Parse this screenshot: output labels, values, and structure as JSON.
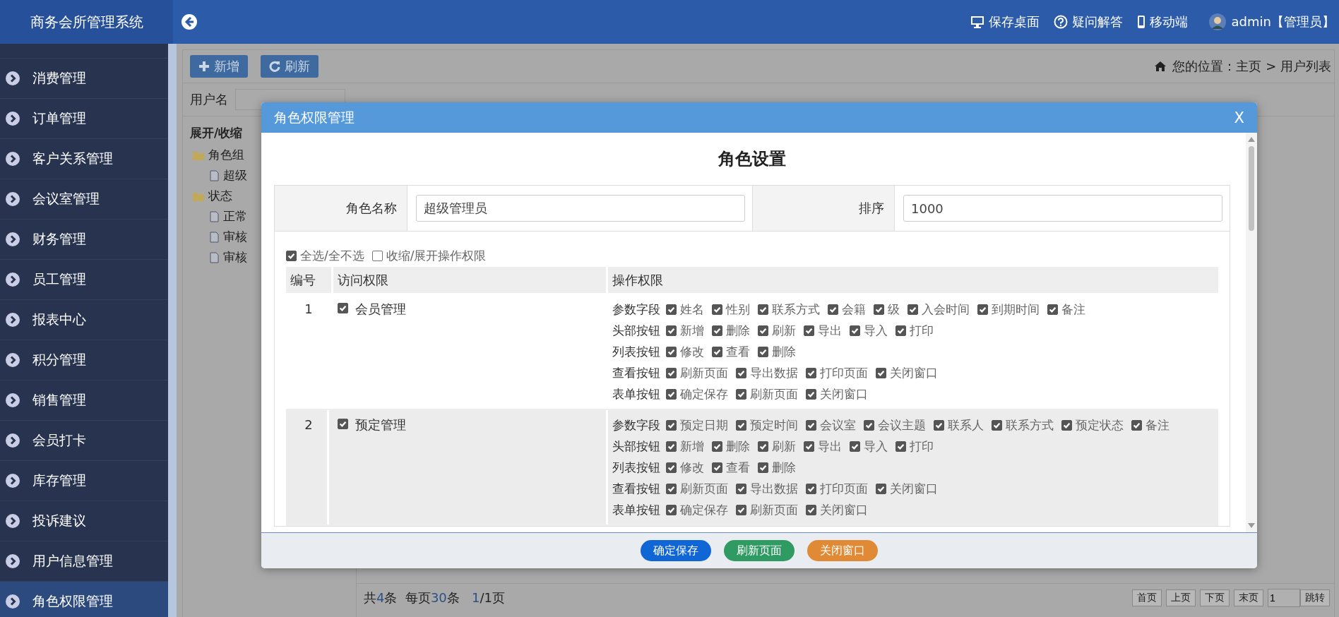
{
  "header": {
    "title": "商务会所管理系统",
    "links": [
      {
        "kind": "desktop",
        "label": "保存桌面"
      },
      {
        "kind": "help",
        "label": "疑问解答"
      },
      {
        "kind": "mobile",
        "label": "移动端"
      }
    ],
    "user": "admin【管理员】"
  },
  "sidebar": {
    "items": [
      {
        "label": "消费管理",
        "selected": false
      },
      {
        "label": "订单管理",
        "selected": false
      },
      {
        "label": "客户关系管理",
        "selected": false
      },
      {
        "label": "会议室管理",
        "selected": false
      },
      {
        "label": "财务管理",
        "selected": false
      },
      {
        "label": "员工管理",
        "selected": false
      },
      {
        "label": "报表中心",
        "selected": false
      },
      {
        "label": "积分管理",
        "selected": false
      },
      {
        "label": "销售管理",
        "selected": false
      },
      {
        "label": "会员打卡",
        "selected": false
      },
      {
        "label": "库存管理",
        "selected": false
      },
      {
        "label": "投诉建议",
        "selected": false
      },
      {
        "label": "用户信息管理",
        "selected": false
      },
      {
        "label": "角色权限管理",
        "selected": true
      }
    ]
  },
  "toolbar": {
    "buttons": [
      {
        "kind": "add",
        "label": "新增"
      },
      {
        "kind": "refresh",
        "label": "刷新"
      }
    ],
    "breadcrumb": "您的位置：主页 > 用户列表"
  },
  "search": {
    "label": "用户名"
  },
  "tree": {
    "root": "展开/收缩",
    "nodes": [
      {
        "label": "角色组",
        "children": [
          {
            "label": "超级"
          }
        ]
      },
      {
        "label": "状态",
        "children": [
          {
            "label": "正常"
          },
          {
            "label": "审核"
          },
          {
            "label": "审核"
          }
        ]
      }
    ]
  },
  "pager": {
    "summary": [
      {
        "kind": "label",
        "text": "共"
      },
      {
        "kind": "number",
        "text": "4"
      },
      {
        "kind": "label",
        "text": "条  每页"
      },
      {
        "kind": "number",
        "text": "30"
      },
      {
        "kind": "label",
        "text": "条   "
      },
      {
        "kind": "number",
        "text": "1"
      },
      {
        "kind": "label",
        "text": "/1页"
      }
    ],
    "buttons": [
      "首页",
      "上页",
      "下页",
      "末页"
    ],
    "page_input": "1",
    "go": "跳转"
  },
  "modal": {
    "title": "角色权限管理",
    "close": "X",
    "heading": "角色设置",
    "fields": [
      {
        "label": "角色名称",
        "value": "超级管理员"
      },
      {
        "label": "排序",
        "value": "1000"
      }
    ],
    "options": [
      {
        "label": "全选/全不选",
        "checked": true
      },
      {
        "label": "收缩/展开操作权限",
        "checked": false
      }
    ],
    "columns": [
      "编号",
      "访问权限",
      "操作权限"
    ],
    "rows": [
      {
        "no": "1",
        "module": "会员管理",
        "checked": true,
        "groups": [
          {
            "label": "参数字段",
            "items": [
              {
                "label": "姓名",
                "checked": true
              },
              {
                "label": "性别",
                "checked": true
              },
              {
                "label": "联系方式",
                "checked": true
              },
              {
                "label": "会籍",
                "checked": true
              },
              {
                "label": "级",
                "checked": true
              },
              {
                "label": "入会时间",
                "checked": true
              },
              {
                "label": "到期时间",
                "checked": true
              },
              {
                "label": "备注",
                "checked": true
              }
            ]
          },
          {
            "label": "头部按钮",
            "items": [
              {
                "label": "新增",
                "checked": true
              },
              {
                "label": "删除",
                "checked": true
              },
              {
                "label": "刷新",
                "checked": true
              },
              {
                "label": "导出",
                "checked": true
              },
              {
                "label": "导入",
                "checked": true
              },
              {
                "label": "打印",
                "checked": true
              }
            ]
          },
          {
            "label": "列表按钮",
            "items": [
              {
                "label": "修改",
                "checked": true
              },
              {
                "label": "查看",
                "checked": true
              },
              {
                "label": "删除",
                "checked": true
              }
            ]
          },
          {
            "label": "查看按钮",
            "items": [
              {
                "label": "刷新页面",
                "checked": true
              },
              {
                "label": "导出数据",
                "checked": true
              },
              {
                "label": "打印页面",
                "checked": true
              },
              {
                "label": "关闭窗口",
                "checked": true
              }
            ]
          },
          {
            "label": "表单按钮",
            "items": [
              {
                "label": "确定保存",
                "checked": true
              },
              {
                "label": "刷新页面",
                "checked": true
              },
              {
                "label": "关闭窗口",
                "checked": true
              }
            ]
          }
        ]
      },
      {
        "no": "2",
        "module": "预定管理",
        "checked": true,
        "groups": [
          {
            "label": "参数字段",
            "items": [
              {
                "label": "预定日期",
                "checked": true
              },
              {
                "label": "预定时间",
                "checked": true
              },
              {
                "label": "会议室",
                "checked": true
              },
              {
                "label": "会议主题",
                "checked": true
              },
              {
                "label": "联系人",
                "checked": true
              },
              {
                "label": "联系方式",
                "checked": true
              },
              {
                "label": "预定状态",
                "checked": true
              },
              {
                "label": "备注",
                "checked": true
              }
            ]
          },
          {
            "label": "头部按钮",
            "items": [
              {
                "label": "新增",
                "checked": true
              },
              {
                "label": "删除",
                "checked": true
              },
              {
                "label": "刷新",
                "checked": true
              },
              {
                "label": "导出",
                "checked": true
              },
              {
                "label": "导入",
                "checked": true
              },
              {
                "label": "打印",
                "checked": true
              }
            ]
          },
          {
            "label": "列表按钮",
            "items": [
              {
                "label": "修改",
                "checked": true
              },
              {
                "label": "查看",
                "checked": true
              },
              {
                "label": "删除",
                "checked": true
              }
            ]
          },
          {
            "label": "查看按钮",
            "items": [
              {
                "label": "刷新页面",
                "checked": true
              },
              {
                "label": "导出数据",
                "checked": true
              },
              {
                "label": "打印页面",
                "checked": true
              },
              {
                "label": "关闭窗口",
                "checked": true
              }
            ]
          },
          {
            "label": "表单按钮",
            "items": [
              {
                "label": "确定保存",
                "checked": true
              },
              {
                "label": "刷新页面",
                "checked": true
              },
              {
                "label": "关闭窗口",
                "checked": true
              }
            ]
          }
        ]
      }
    ],
    "buttons": [
      {
        "kind": "save",
        "label": "确定保存"
      },
      {
        "kind": "refresh",
        "label": "刷新页面"
      },
      {
        "kind": "close",
        "label": "关闭窗口"
      }
    ]
  }
}
